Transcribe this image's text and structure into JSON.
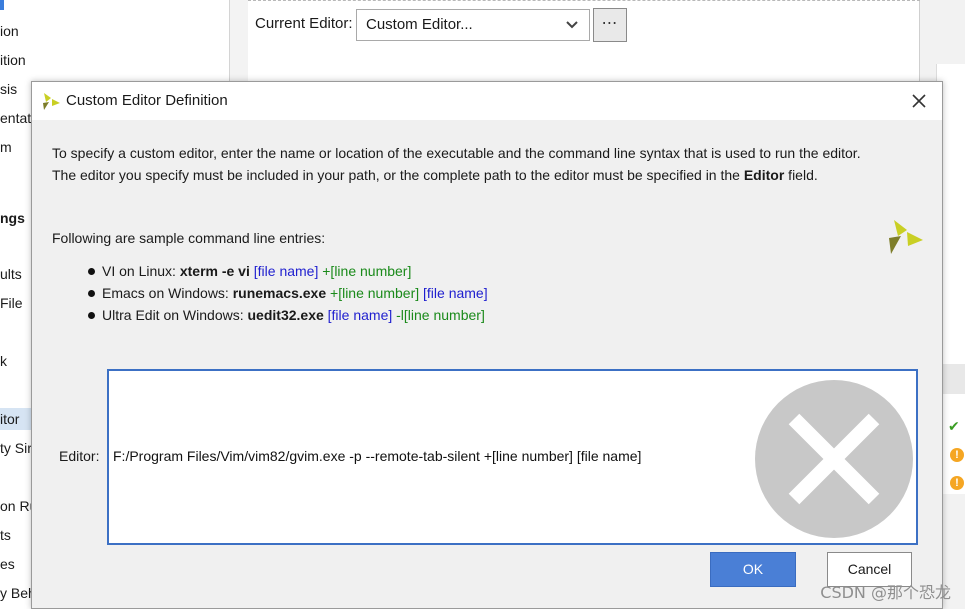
{
  "background": {
    "sidebar_items": [
      "ion",
      "ition",
      "sis",
      "entati",
      "m",
      "ngs",
      "ults",
      "File",
      "k",
      "itor",
      "ty Sir",
      "on Ru",
      "ts",
      "es",
      "y Beh"
    ],
    "current_editor_label": "Current Editor:",
    "current_editor_value": "Custom Editor...",
    "more_button": "⋯"
  },
  "dialog": {
    "title": "Custom Editor Definition",
    "description": {
      "line1": "To specify a custom editor, enter the name or location of the executable and the command line syntax that is used to run the editor.",
      "line2_before": "The editor you specify must be included in your path, or the complete path to the editor must be specified in the ",
      "line2_bold": "Editor",
      "line2_after": " field."
    },
    "samples_title": "Following are sample command line entries:",
    "samples": [
      {
        "prefix": "VI on Linux: ",
        "cmd": "xterm -e vi",
        "part1": " [file name]",
        "part1_color": "#1f1fcf",
        "part2": " +[line number]",
        "part2_color": "#1a8a1a"
      },
      {
        "prefix": "Emacs on Windows: ",
        "cmd": "runemacs.exe",
        "part1": " +[line number]",
        "part1_color": "#1a8a1a",
        "part2": " [file name]",
        "part2_color": "#1f1fcf"
      },
      {
        "prefix": "Ultra Edit on Windows: ",
        "cmd": "uedit32.exe",
        "part1": " [file name]",
        "part1_color": "#1f1fcf",
        "part2": " -l[line number]",
        "part2_color": "#1a8a1a"
      }
    ],
    "editor_label": "Editor:",
    "editor_value": "F:/Program Files/Vim/vim82/gvim.exe -p --remote-tab-silent +[line number] [file name]",
    "ok_label": "OK",
    "cancel_label": "Cancel",
    "close_icon": "close-icon",
    "invalid_icon": "invalid-x-icon"
  },
  "watermark": "CSDN @那个恐龙",
  "colors": {
    "accent": "#4a7fd6",
    "field_border": "#3c70c4",
    "file_name": "#1f1fcf",
    "line_number": "#1a8a1a",
    "logo": "#c9cf24"
  }
}
